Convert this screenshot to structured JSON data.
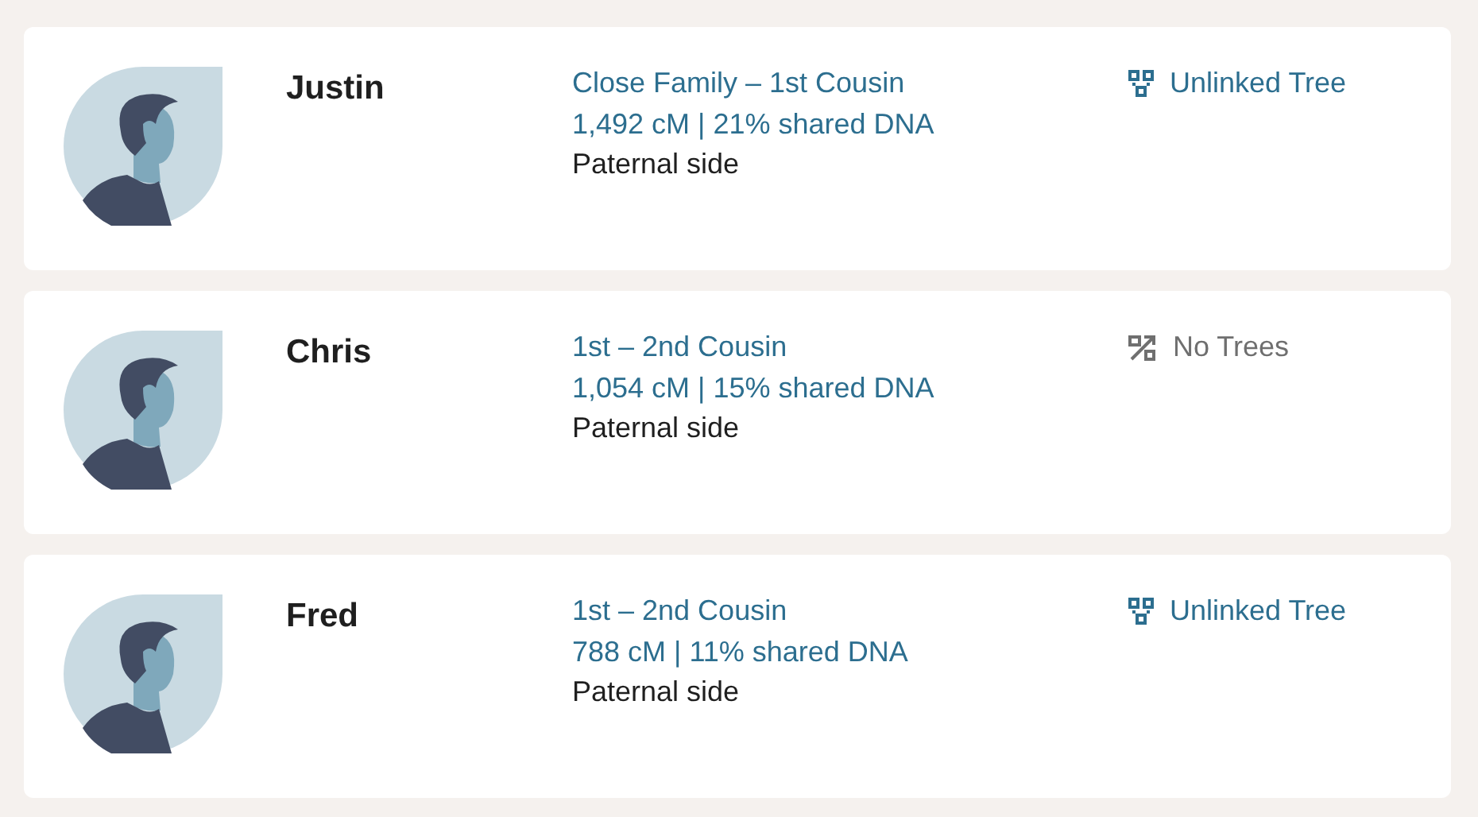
{
  "matches": [
    {
      "name": "Justin",
      "relationship": "Close Family – 1st Cousin",
      "shared": "1,492 cM | 21% shared DNA",
      "side": "Paternal side",
      "tree": {
        "kind": "unlinked",
        "label": "Unlinked Tree"
      }
    },
    {
      "name": "Chris",
      "relationship": "1st – 2nd Cousin",
      "shared": "1,054 cM | 15% shared DNA",
      "side": "Paternal side",
      "tree": {
        "kind": "none",
        "label": "No Trees"
      }
    },
    {
      "name": "Fred",
      "relationship": "1st – 2nd Cousin",
      "shared": "788 cM | 11% shared DNA",
      "side": "Paternal side",
      "tree": {
        "kind": "unlinked",
        "label": "Unlinked Tree"
      }
    }
  ]
}
